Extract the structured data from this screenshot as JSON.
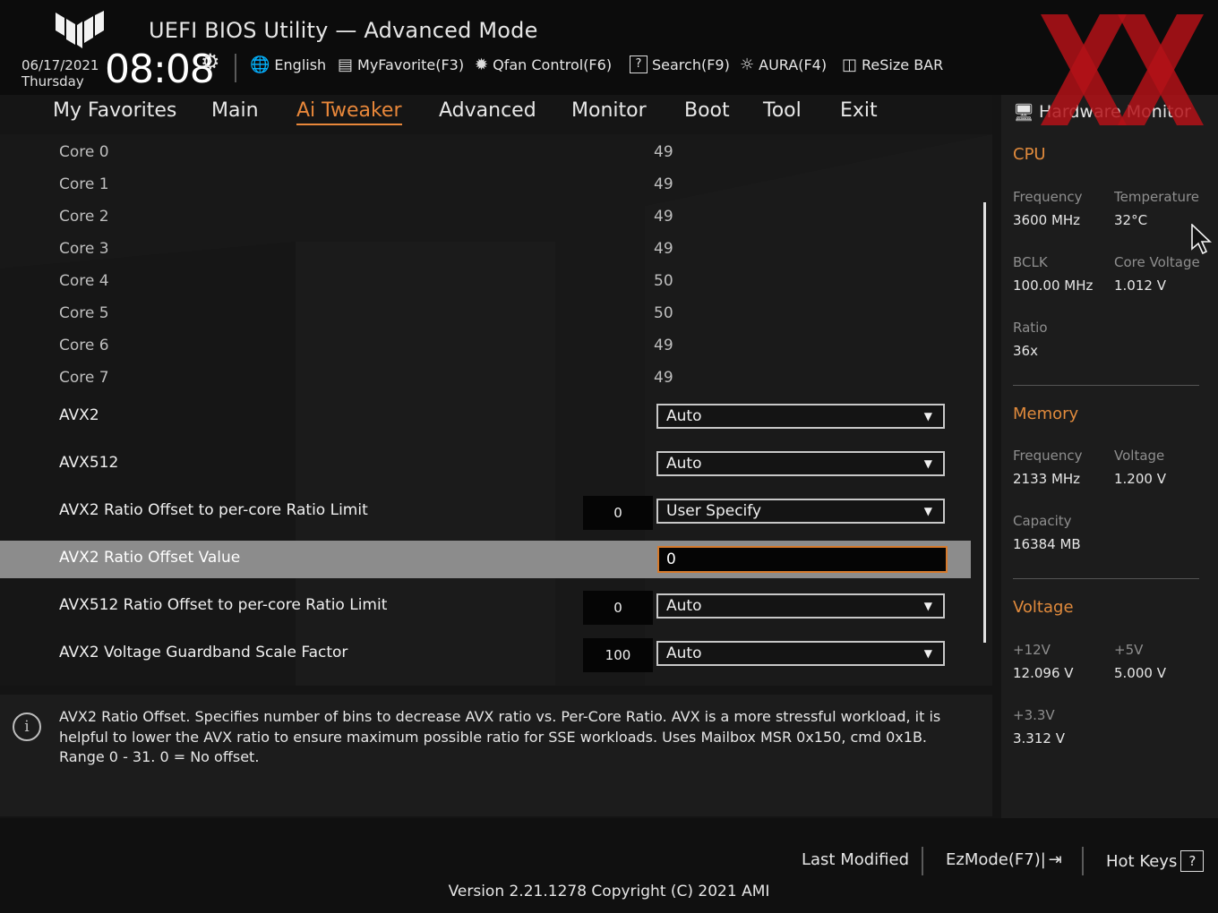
{
  "header": {
    "app_title": "UEFI BIOS Utility — Advanced Mode",
    "date": "06/17/2021",
    "day": "Thursday",
    "time": "08:08",
    "toolbar": [
      {
        "label": "English",
        "icon": "globe-icon"
      },
      {
        "label": "MyFavorite(F3)",
        "icon": "favorite-icon"
      },
      {
        "label": "Qfan Control(F6)",
        "icon": "fan-icon"
      },
      {
        "label": "Search(F9)",
        "icon": "search-help-icon"
      },
      {
        "label": "AURA(F4)",
        "icon": "aura-light-icon"
      },
      {
        "label": "ReSize BAR",
        "icon": "resize-bar-icon"
      }
    ]
  },
  "nav": {
    "tabs": [
      "My Favorites",
      "Main",
      "Ai Tweaker",
      "Advanced",
      "Monitor",
      "Boot",
      "Tool",
      "Exit"
    ],
    "active": "Ai Tweaker"
  },
  "main": {
    "cores": [
      {
        "label": "Core 0",
        "value": "49"
      },
      {
        "label": "Core 1",
        "value": "49"
      },
      {
        "label": "Core 2",
        "value": "49"
      },
      {
        "label": "Core 3",
        "value": "49"
      },
      {
        "label": "Core 4",
        "value": "50"
      },
      {
        "label": "Core 5",
        "value": "50"
      },
      {
        "label": "Core 6",
        "value": "49"
      },
      {
        "label": "Core 7",
        "value": "49"
      }
    ],
    "settings": [
      {
        "label": "AVX2",
        "current": "",
        "control": "Auto"
      },
      {
        "label": "AVX512",
        "current": "",
        "control": "Auto"
      },
      {
        "label": "AVX2 Ratio Offset to per-core Ratio Limit",
        "current": "0",
        "control": "User Specify"
      },
      {
        "label": "AVX2 Ratio Offset Value",
        "current": "",
        "control": "0"
      },
      {
        "label": "AVX512 Ratio Offset to per-core Ratio Limit",
        "current": "0",
        "control": "Auto"
      },
      {
        "label": "AVX2 Voltage Guardband Scale Factor",
        "current": "100",
        "control": "Auto"
      }
    ]
  },
  "info": {
    "text": "AVX2 Ratio Offset. Specifies number of bins to decrease AVX ratio vs. Per-Core Ratio. AVX is a more stressful workload, it is helpful to lower the AVX ratio to ensure maximum possible ratio for SSE workloads. Uses Mailbox MSR 0x150, cmd 0x1B. Range 0 - 31. 0 = No offset."
  },
  "hardware_monitor": {
    "title": "Hardware Monitor",
    "cpu": {
      "section": "CPU",
      "frequency_label": "Frequency",
      "frequency": "3600 MHz",
      "temperature_label": "Temperature",
      "temperature": "32°C",
      "bclk_label": "BCLK",
      "bclk": "100.00 MHz",
      "core_voltage_label": "Core Voltage",
      "core_voltage": "1.012 V",
      "ratio_label": "Ratio",
      "ratio": "36x"
    },
    "memory": {
      "section": "Memory",
      "frequency_label": "Frequency",
      "frequency": "2133 MHz",
      "voltage_label": "Voltage",
      "voltage": "1.200 V",
      "capacity_label": "Capacity",
      "capacity": "16384 MB"
    },
    "voltage": {
      "section": "Voltage",
      "v12_label": "+12V",
      "v12": "12.096 V",
      "v5_label": "+5V",
      "v5": "5.000 V",
      "v33_label": "+3.3V",
      "v33": "3.312 V"
    }
  },
  "footer": {
    "last_modified": "Last Modified",
    "ezmode": "EzMode(F7)|",
    "hotkeys": "Hot Keys",
    "version": "Version 2.21.1278 Copyright (C) 2021 AMI"
  },
  "colors": {
    "accent": "#e8873a",
    "watermark": "#b31217"
  }
}
